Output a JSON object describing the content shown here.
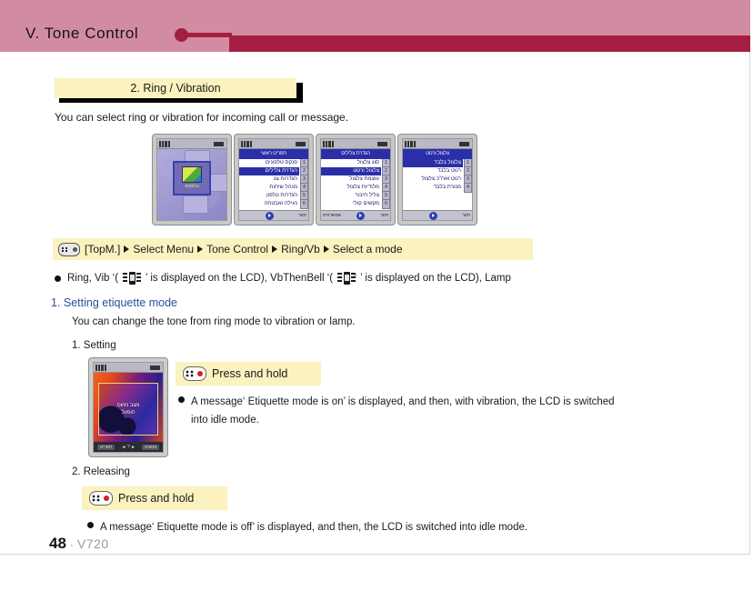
{
  "header": {
    "title": "V. Tone Control",
    "band_color": "#d28ca2",
    "rule_color": "#a41e42"
  },
  "section": {
    "title": "2. Ring / Vibration",
    "intro": "You can select ring or vibration for incoming call or message.",
    "box_color": "#fbf2c0"
  },
  "screenshots": [
    {
      "kind": "idle",
      "tile_label": "טלפונים",
      "icon": "cube-icon"
    },
    {
      "kind": "menu",
      "title": "תפריט ראשי",
      "items": [
        {
          "num": "1",
          "label": "פנקס טלפונים",
          "selected": false
        },
        {
          "num": "2",
          "label": "הגדרת צלילים",
          "selected": true
        },
        {
          "num": "3",
          "label": "הגדרות צג",
          "selected": false
        },
        {
          "num": "4",
          "label": "מנהל שיחות",
          "selected": false
        },
        {
          "num": "5",
          "label": "הגדרות טלפון",
          "selected": false
        },
        {
          "num": "6",
          "label": "נעילה ואבטחה",
          "selected": false
        }
      ],
      "soft_right": "חזור",
      "soft_left": ""
    },
    {
      "kind": "menu",
      "title": "הגדרת צלילים",
      "items": [
        {
          "num": "1",
          "label": "סוג צלצול",
          "selected": false
        },
        {
          "num": "2",
          "label": "צלצול ורטט",
          "selected": true
        },
        {
          "num": "3",
          "label": "עוצמת צלצול",
          "selected": false
        },
        {
          "num": "4",
          "label": "מלודיות צלצול",
          "selected": false
        },
        {
          "num": "5",
          "label": "צליל חיבור",
          "selected": false
        },
        {
          "num": "6",
          "label": "מקשים קולי",
          "selected": false
        }
      ],
      "soft_right": "חזור",
      "soft_left": "אפשרויות"
    },
    {
      "kind": "menu",
      "title": "צלצול ורטט",
      "items": [
        {
          "num": "1",
          "label": "צלצול בלבד",
          "selected": true
        },
        {
          "num": "2",
          "label": "רטט בלבד",
          "selected": false
        },
        {
          "num": "3",
          "label": "רטט ואח\"כ צלצול",
          "selected": false
        },
        {
          "num": "4",
          "label": "מנורת בלבד",
          "selected": false
        }
      ],
      "soft_right": "חזור",
      "soft_left": ""
    }
  ],
  "navpath": {
    "icon": "keypad-key-icon",
    "steps": [
      "[TopM.]",
      "Select Menu",
      "Tone Control",
      "Ring/Vb",
      "Select a mode"
    ]
  },
  "modes_line": {
    "prefix": "Ring, Vib ‘(",
    "mid": "’ is displayed on the LCD), VbThenBell ‘(",
    "suffix": "’ is displayed on the LCD), Lamp",
    "icon1": "vibrate-phone-icon",
    "icon2": "vibrate-phone-music-icon"
  },
  "etiquette": {
    "heading": "1. Setting etiquette mode",
    "heading_color": "#2b4f9e",
    "description": "You can change the tone from ring mode to vibration or lamp.",
    "step1_label": "1. Setting",
    "step2_label": "2. Releasing",
    "press_hold_label": "Press and hold",
    "photo": {
      "line1": "מצב נימוס",
      "line2": "הופעל",
      "soft_left": "תפריט",
      "soft_mid": "◄ ? ►",
      "soft_right": "אנשים"
    },
    "setting_bullet_line1": "A message‘ Etiquette mode is on’ is displayed, and then, with vibration, the LCD is switched",
    "setting_bullet_line2": "into idle mode.",
    "releasing_bullet": "A message‘ Etiquette mode is off’ is displayed, and then, the LCD is switched into idle mode."
  },
  "footer": {
    "page_number": "48",
    "separator": "·",
    "model": "V720"
  }
}
